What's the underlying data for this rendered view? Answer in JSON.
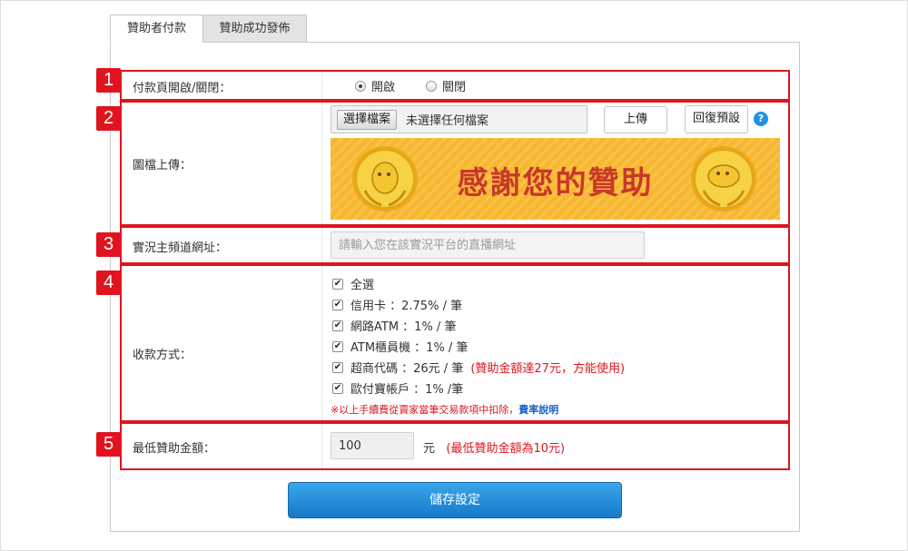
{
  "tabs": [
    "贊助者付款",
    "贊助成功發佈"
  ],
  "badges": [
    "1",
    "2",
    "3",
    "4",
    "5"
  ],
  "row_payment_page": {
    "label": "付款頁開啟/關閉：",
    "option_on": "開啟",
    "option_off": "關閉",
    "selected": "開啟"
  },
  "row_image_upload": {
    "label": "圖檔上傳：",
    "file_button": "選擇檔案",
    "file_status": "未選擇任何檔案",
    "upload_button": "上傳",
    "reset_button": "回復預設",
    "help_icon": "?",
    "banner_text": "感謝您的贊助"
  },
  "row_channel_url": {
    "label": "實況主頻道網址：",
    "placeholder": "請輸入您在該實況平台的直播網址"
  },
  "row_payment_methods": {
    "label": "收款方式：",
    "check_mark": "✔",
    "methods": [
      {
        "text": "全選",
        "note": ""
      },
      {
        "text": "信用卡 ：2.75% / 筆",
        "note": ""
      },
      {
        "text": "網路ATM ：1% / 筆",
        "note": ""
      },
      {
        "text": "ATM櫃員機 ：1% / 筆",
        "note": ""
      },
      {
        "text": "超商代碼 ：26元 / 筆",
        "note": "(贊助金額達27元，方能使用)"
      },
      {
        "text": "歐付寶帳戶 ：1% /筆",
        "note": ""
      }
    ],
    "fee_note": "※以上手續費從賣家當筆交易款項中扣除，",
    "fee_link": "費率說明"
  },
  "row_min_amount": {
    "label": "最低贊助金額：",
    "value": "100",
    "unit": "元",
    "note": "(最低贊助金額為10元)"
  },
  "save_button": "儲存設定",
  "colors": {
    "highlight_red": "#e0141e",
    "accent_blue": "#1e90e6",
    "banner_orange": "#f7b731"
  }
}
